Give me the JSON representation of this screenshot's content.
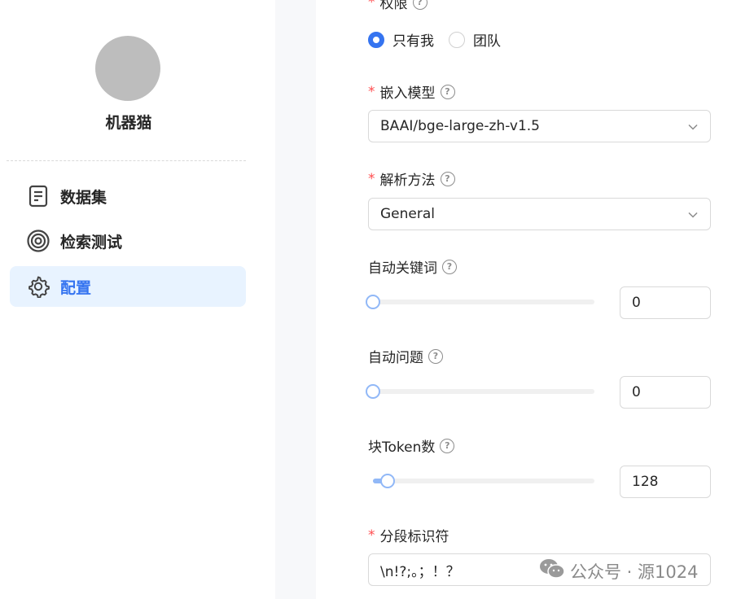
{
  "sidebar": {
    "kb_name": "机器猫",
    "items": [
      {
        "label": "数据集",
        "icon": "document-icon",
        "active": false
      },
      {
        "label": "检索测试",
        "icon": "target-icon",
        "active": false
      },
      {
        "label": "配置",
        "icon": "gear-icon",
        "active": true
      }
    ]
  },
  "form": {
    "permission": {
      "label": "权限",
      "options": [
        "只有我",
        "团队"
      ],
      "selected": "只有我"
    },
    "embedding_model": {
      "label": "嵌入模型",
      "value": "BAAI/bge-large-zh-v1.5"
    },
    "parse_method": {
      "label": "解析方法",
      "value": "General"
    },
    "auto_keywords": {
      "label": "自动关键词",
      "value": "0",
      "slider_fraction": 0
    },
    "auto_questions": {
      "label": "自动问题",
      "value": "0",
      "slider_fraction": 0
    },
    "chunk_tokens": {
      "label": "块Token数",
      "value": "128",
      "slider_fraction": 0.065
    },
    "delimiter": {
      "label": "分段标识符",
      "value": "\\n!?;。；！？"
    }
  },
  "watermark": {
    "text": "公众号 · 源1024"
  },
  "colors": {
    "accent": "#3574f0",
    "active_bg": "#e8f3ff",
    "required": "#ff4d4f",
    "slider": "#91b8f7"
  }
}
